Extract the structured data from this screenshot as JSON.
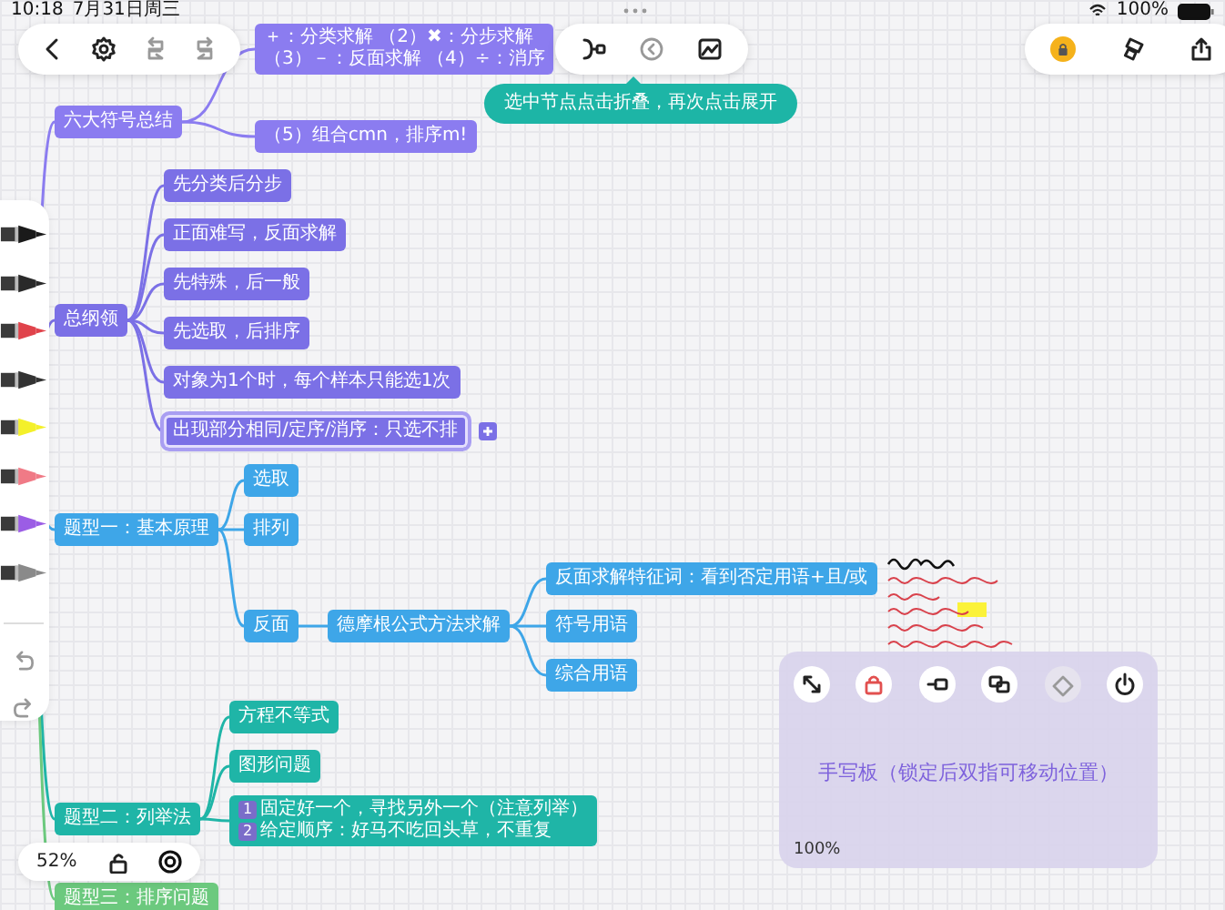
{
  "status_bar": {
    "time": "10:18",
    "date": "7月31日周三",
    "battery": "100%"
  },
  "tooltip": {
    "text": "选中节点点击折叠，再次点击展开"
  },
  "palette": {
    "pens": [
      {
        "color": "#1a1a1a"
      },
      {
        "color": "#2a2a2a"
      },
      {
        "color": "#e0434b"
      },
      {
        "color": "#333333"
      },
      {
        "color": "#f4f02a"
      },
      {
        "color": "#f07a86"
      },
      {
        "color": "#9b5de5"
      },
      {
        "color": "#8a8a8a"
      }
    ]
  },
  "mind_map": {
    "branches": [
      {
        "text": "六大符号总结",
        "color": "#8b7cf0",
        "selected": false,
        "children": [
          {
            "selected": false,
            "lines": [
              {
                "text": "＋：分类求解 （2）✖：分步求解"
              },
              {
                "text": "（3）－：反面求解 （4）÷：消序"
              }
            ]
          },
          {
            "text": "（5）组合cmn，排序m!",
            "selected": false
          }
        ]
      },
      {
        "text": "总纲领",
        "color": "#7b70e6",
        "selected": false,
        "children": [
          {
            "text": "先分类后分步",
            "selected": false
          },
          {
            "text": "正面难写，反面求解",
            "selected": false
          },
          {
            "text": "先特殊，后一般",
            "selected": false
          },
          {
            "text": "先选取，后排序",
            "selected": false
          },
          {
            "text": "对象为1个时，每个样本只能选1次",
            "selected": false
          },
          {
            "text": "出现部分相同/定序/消序：只选不排",
            "selected": true
          }
        ]
      },
      {
        "text": "题型一：基本原理",
        "color": "#3ea6e8",
        "selected": false,
        "children": [
          {
            "text": "选取",
            "selected": false
          },
          {
            "text": "排列",
            "selected": false
          },
          {
            "text": "反面",
            "selected": false,
            "children": [
              {
                "text": "德摩根公式方法求解",
                "selected": false,
                "children": [
                  {
                    "text": "反面求解特征词：看到否定用语+且/或",
                    "selected": false
                  },
                  {
                    "text": "符号用语",
                    "selected": false
                  },
                  {
                    "text": "综合用语",
                    "selected": false
                  }
                ]
              }
            ]
          }
        ]
      },
      {
        "text": "题型二：列举法",
        "color": "#1fb5a7",
        "selected": false,
        "children": [
          {
            "text": "方程不等式",
            "selected": false
          },
          {
            "text": "图形问题",
            "selected": false
          },
          {
            "selected": false,
            "lines": [
              {
                "badge": "1",
                "text": "固定好一个，寻找另外一个（注意列举）"
              },
              {
                "badge": "2",
                "text": "给定顺序：好马不吃回头草，不重复"
              }
            ]
          }
        ]
      },
      {
        "text": "题型三：排序问题",
        "color": "#6cc97e",
        "selected": false
      }
    ]
  },
  "zoom_bar": {
    "zoom": "52%"
  },
  "handwriting_pad": {
    "title": "手写板（锁定后双指可移动位置）",
    "zoom": "100%"
  }
}
